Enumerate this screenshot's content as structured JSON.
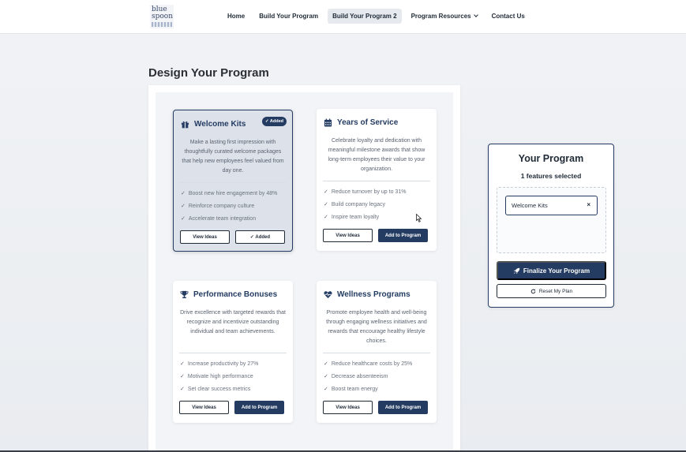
{
  "logo": {
    "line1": "blue",
    "line2": "spoon"
  },
  "nav": {
    "items": [
      {
        "label": "Home"
      },
      {
        "label": "Build Your Program"
      },
      {
        "label": "Build Your Program 2"
      },
      {
        "label": "Program Resources"
      },
      {
        "label": "Contact Us"
      }
    ],
    "active_index": 2
  },
  "page_title": "Design Your Program",
  "cards": [
    {
      "icon": "gift-icon",
      "title": "Welcome Kits",
      "added": true,
      "badge": "✓ Added",
      "description": "Make a lasting first impression with thoughtfully curated welcome packages that help new employees feel valued from day one.",
      "features": [
        "Boost new hire engagement by 48%",
        "Reinforce company culture",
        "Accelerate team integration"
      ],
      "view_label": "View Ideas",
      "action_label": "✓ Added"
    },
    {
      "icon": "calendar-icon",
      "title": "Years of Service",
      "added": false,
      "description": "Celebrate loyalty and dedication with meaningful milestone awards that show long-term employees their value to your organization.",
      "features": [
        "Reduce turnover by up to 31%",
        "Build company legacy",
        "Inspire team loyalty"
      ],
      "view_label": "View Ideas",
      "action_label": "Add to Program"
    },
    {
      "icon": "trophy-icon",
      "title": "Performance Bonuses",
      "added": false,
      "description": "Drive excellence with targeted rewards that recognize and incentivize outstanding individual and team achievements.",
      "features": [
        "Increase productivity by 27%",
        "Motivate high performance",
        "Set clear success metrics"
      ],
      "view_label": "View Ideas",
      "action_label": "Add to Program"
    },
    {
      "icon": "heartbeat-icon",
      "title": "Wellness Programs",
      "added": false,
      "description": "Promote employee health and well-being through engaging wellness initiatives and rewards that encourage healthy lifestyle choices.",
      "features": [
        "Reduce healthcare costs by 25%",
        "Decrease absenteeism",
        "Boost team energy"
      ],
      "view_label": "View Ideas",
      "action_label": "Add to Program"
    }
  ],
  "panel": {
    "title": "Your Program",
    "count_text": "1 features selected",
    "selected": [
      {
        "label": "Welcome Kits",
        "remove": "×"
      }
    ],
    "finalize_label": "Finalize Your Program",
    "reset_label": "Reset My Plan"
  },
  "colors": {
    "brand": "#243c62",
    "active_nav_bg": "#e6e9ee",
    "added_card_bg": "#dde2ea"
  }
}
